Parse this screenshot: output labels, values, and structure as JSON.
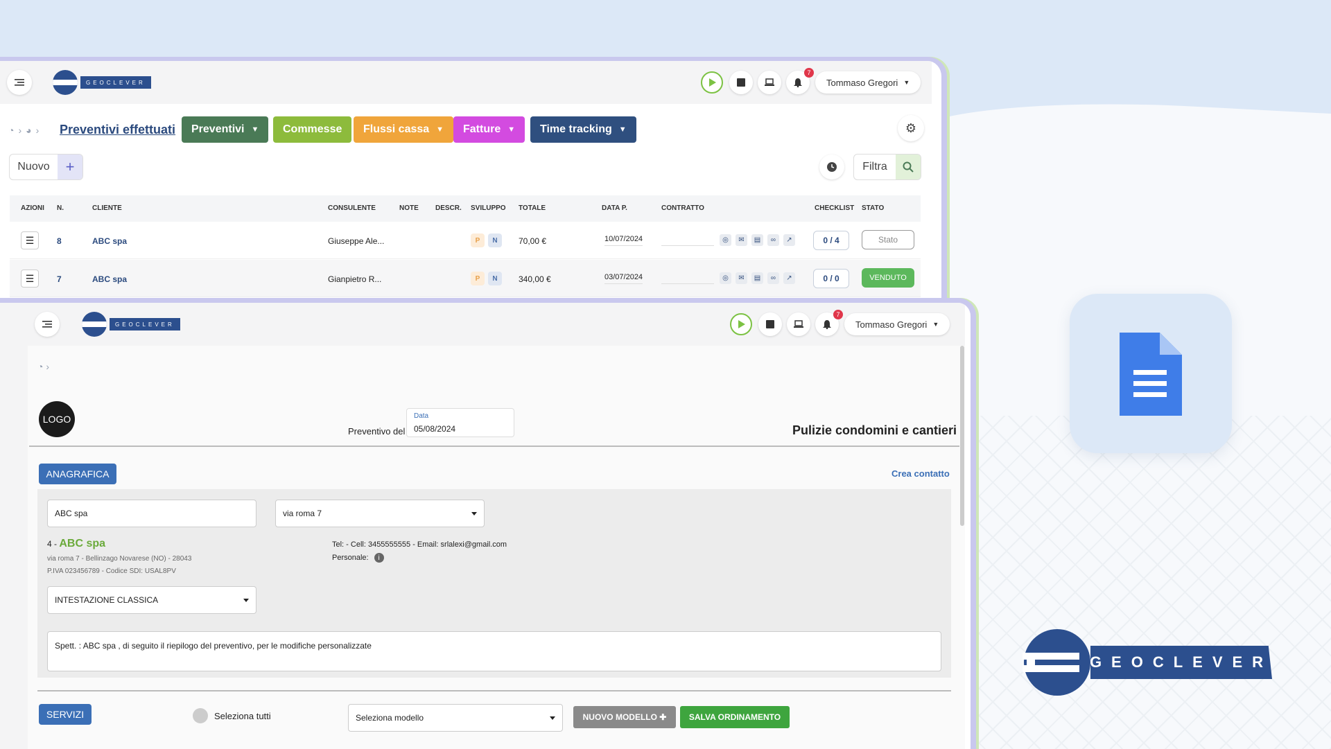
{
  "window1": {
    "topbar": {
      "user": "Tommaso Gregori",
      "notifications": "7",
      "brand": "GEOCLEVER"
    },
    "breadcrumb_title": "Preventivi effettuati",
    "nav": [
      {
        "label": "Preventivi",
        "color": "#4a7a56"
      },
      {
        "label": "Commesse",
        "color": "#8dbb3c"
      },
      {
        "label": "Flussi cassa",
        "color": "#f0a53b"
      },
      {
        "label": "Fatture",
        "color": "#d34be0"
      },
      {
        "label": "Time tracking",
        "color": "#2f4f7f"
      }
    ],
    "new_label": "Nuovo",
    "filter_label": "Filtra",
    "columns": [
      "AZIONI",
      "N.",
      "CLIENTE",
      "CONSULENTE",
      "NOTE",
      "DESCR.",
      "SVILUPPO",
      "TOTALE",
      "DATA P.",
      "CONTRATTO",
      "CHECKLIST",
      "STATO"
    ],
    "rows": [
      {
        "num": "8",
        "cliente": "ABC spa",
        "consulente": "Giuseppe Ale...",
        "chip_p": "P",
        "chip_n": "N",
        "totale": "70,00 €",
        "data": "10/07/2024",
        "checklist": "0 / 4",
        "stato": "Stato"
      },
      {
        "num": "7",
        "cliente": "ABC spa",
        "consulente": "Gianpietro R...",
        "chip_p": "P",
        "chip_n": "N",
        "totale": "340,00 €",
        "data": "03/07/2024",
        "checklist": "0 / 0",
        "stato": "VENDUTO"
      }
    ]
  },
  "window2": {
    "topbar": {
      "user": "Tommaso Gregori",
      "notifications": "7",
      "brand": "GEOCLEVER"
    },
    "logo_text": "LOGO",
    "preventivo_label": "Preventivo del",
    "date_label": "Data",
    "date_value": "05/08/2024",
    "company_title": "Pulizie condomini e cantieri",
    "anagrafica_label": "ANAGRAFICA",
    "crea_contatto": "Crea contatto",
    "cliente_input": "ABC spa",
    "indirizzo_select": "via roma 7",
    "cliente_num": "4 -",
    "cliente_name": "ABC spa",
    "address_line": "via roma 7 - Bellinzago Novarese (NO) - 28043",
    "piva_line": "P.IVA 023456789 - Codice SDI: USAL8PV",
    "contact_line": "Tel: - Cell: 3455555555 - Email: srlalexi@gmail.com",
    "personale_label": "Personale:",
    "intestazione_select": "INTESTAZIONE CLASSICA",
    "textarea_text": "Spett. : ABC spa , di seguito il riepilogo del preventivo, per le modifiche personalizzate",
    "servizi_label": "SERVIZI",
    "seleziona_tutti": "Seleziona tutti",
    "modello_select": "Seleziona modello",
    "nuovo_modello": "NUOVO MODELLO ✚",
    "salva_ordinamento": "SALVA ORDINAMENTO"
  },
  "brand_large": "GEOCLEVER",
  "colors": {
    "accent_blue": "#3b6fb6",
    "green": "#4caf50",
    "brand_navy": "#2c4f8e"
  }
}
